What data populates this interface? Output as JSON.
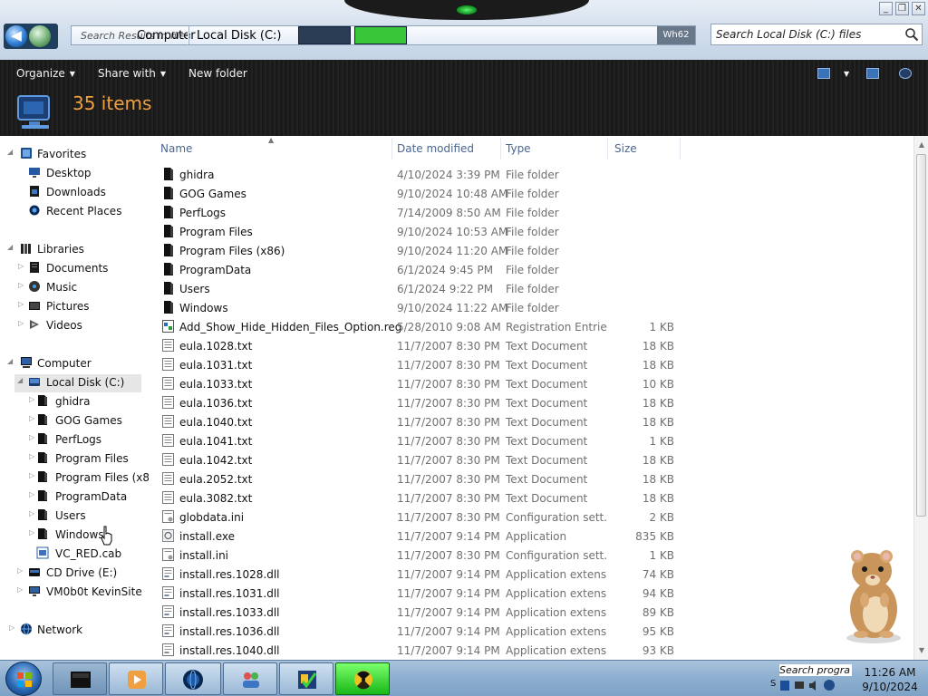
{
  "window": {
    "breadcrumb_ghost": "Search Results in files",
    "breadcrumb": [
      "Computer",
      "Local Disk (C:)"
    ],
    "refresh_label": "Wh62",
    "search_placeholder": "Search Local Disk (C:) files",
    "controls": [
      "minimize",
      "restore",
      "close"
    ]
  },
  "toolbar": {
    "organize": "Organize",
    "share_with": "Share with",
    "new_folder": "New folder"
  },
  "details": {
    "items_count": "35 items"
  },
  "nav": {
    "favorites": {
      "label": "Favorites",
      "items": [
        "Desktop",
        "Downloads",
        "Recent Places"
      ]
    },
    "libraries": {
      "label": "Libraries",
      "items": [
        "Documents",
        "Music",
        "Pictures",
        "Videos"
      ]
    },
    "computer": {
      "label": "Computer",
      "local_disk": "Local Disk (C:)",
      "local_disk_children": [
        "ghidra",
        "GOG Games",
        "PerfLogs",
        "Program Files",
        "Program Files (x86",
        "ProgramData",
        "Users",
        "Windows",
        "VC_RED.cab"
      ],
      "drives": [
        "CD Drive (E:)",
        "VM0b0t KevinSite"
      ]
    },
    "network": "Network"
  },
  "columns": {
    "name": "Name",
    "date_modified": "Date modified",
    "type": "Type",
    "size": "Size"
  },
  "files": [
    {
      "name": "ghidra",
      "date": "4/10/2024 3:39 PM",
      "type": "File folder",
      "size": "",
      "icon": "folder-icon"
    },
    {
      "name": "GOG Games",
      "date": "9/10/2024 10:48 AM",
      "type": "File folder",
      "size": "",
      "icon": "folder-icon"
    },
    {
      "name": "PerfLogs",
      "date": "7/14/2009 8:50 AM",
      "type": "File folder",
      "size": "",
      "icon": "folder-icon"
    },
    {
      "name": "Program Files",
      "date": "9/10/2024 10:53 AM",
      "type": "File folder",
      "size": "",
      "icon": "folder-icon"
    },
    {
      "name": "Program Files (x86)",
      "date": "9/10/2024 11:20 AM",
      "type": "File folder",
      "size": "",
      "icon": "folder-icon"
    },
    {
      "name": "ProgramData",
      "date": "6/1/2024 9:45 PM",
      "type": "File folder",
      "size": "",
      "icon": "folder-icon"
    },
    {
      "name": "Users",
      "date": "6/1/2024 9:22 PM",
      "type": "File folder",
      "size": "",
      "icon": "folder-icon"
    },
    {
      "name": "Windows",
      "date": "9/10/2024 11:22 AM",
      "type": "File folder",
      "size": "",
      "icon": "folder-icon"
    },
    {
      "name": "Add_Show_Hide_Hidden_Files_Option.reg",
      "date": "5/28/2010 9:08 AM",
      "type": "Registration Entries",
      "size": "1 KB",
      "icon": "registry-file-icon"
    },
    {
      "name": "eula.1028.txt",
      "date": "11/7/2007 8:30 PM",
      "type": "Text Document",
      "size": "18 KB",
      "icon": "text-file-icon"
    },
    {
      "name": "eula.1031.txt",
      "date": "11/7/2007 8:30 PM",
      "type": "Text Document",
      "size": "18 KB",
      "icon": "text-file-icon"
    },
    {
      "name": "eula.1033.txt",
      "date": "11/7/2007 8:30 PM",
      "type": "Text Document",
      "size": "10 KB",
      "icon": "text-file-icon"
    },
    {
      "name": "eula.1036.txt",
      "date": "11/7/2007 8:30 PM",
      "type": "Text Document",
      "size": "18 KB",
      "icon": "text-file-icon"
    },
    {
      "name": "eula.1040.txt",
      "date": "11/7/2007 8:30 PM",
      "type": "Text Document",
      "size": "18 KB",
      "icon": "text-file-icon"
    },
    {
      "name": "eula.1041.txt",
      "date": "11/7/2007 8:30 PM",
      "type": "Text Document",
      "size": "1 KB",
      "icon": "text-file-icon"
    },
    {
      "name": "eula.1042.txt",
      "date": "11/7/2007 8:30 PM",
      "type": "Text Document",
      "size": "18 KB",
      "icon": "text-file-icon"
    },
    {
      "name": "eula.2052.txt",
      "date": "11/7/2007 8:30 PM",
      "type": "Text Document",
      "size": "18 KB",
      "icon": "text-file-icon"
    },
    {
      "name": "eula.3082.txt",
      "date": "11/7/2007 8:30 PM",
      "type": "Text Document",
      "size": "18 KB",
      "icon": "text-file-icon"
    },
    {
      "name": "globdata.ini",
      "date": "11/7/2007 8:30 PM",
      "type": "Configuration sett...",
      "size": "2 KB",
      "icon": "config-file-icon"
    },
    {
      "name": "install.exe",
      "date": "11/7/2007 9:14 PM",
      "type": "Application",
      "size": "835 KB",
      "icon": "application-icon"
    },
    {
      "name": "install.ini",
      "date": "11/7/2007 8:30 PM",
      "type": "Configuration sett...",
      "size": "1 KB",
      "icon": "config-file-icon"
    },
    {
      "name": "install.res.1028.dll",
      "date": "11/7/2007 9:14 PM",
      "type": "Application extens...",
      "size": "74 KB",
      "icon": "dll-file-icon"
    },
    {
      "name": "install.res.1031.dll",
      "date": "11/7/2007 9:14 PM",
      "type": "Application extens...",
      "size": "94 KB",
      "icon": "dll-file-icon"
    },
    {
      "name": "install.res.1033.dll",
      "date": "11/7/2007 9:14 PM",
      "type": "Application extens...",
      "size": "89 KB",
      "icon": "dll-file-icon"
    },
    {
      "name": "install.res.1036.dll",
      "date": "11/7/2007 9:14 PM",
      "type": "Application extens...",
      "size": "95 KB",
      "icon": "dll-file-icon"
    },
    {
      "name": "install.res.1040.dll",
      "date": "11/7/2007 9:14 PM",
      "type": "Application extens...",
      "size": "93 KB",
      "icon": "dll-file-icon"
    }
  ],
  "taskbar": {
    "search_programs": "Search progra",
    "time": "11:26 AM",
    "date": "9/10/2024",
    "pinned": [
      "explorer-icon",
      "media-player-icon",
      "globe-icon",
      "users-icon",
      "checklist-icon",
      "radiation-icon"
    ]
  },
  "colors": {
    "accent_orange": "#f0a040",
    "folder_black": "#111111",
    "header_text": "#4a6690",
    "meta_gray": "#707070"
  }
}
